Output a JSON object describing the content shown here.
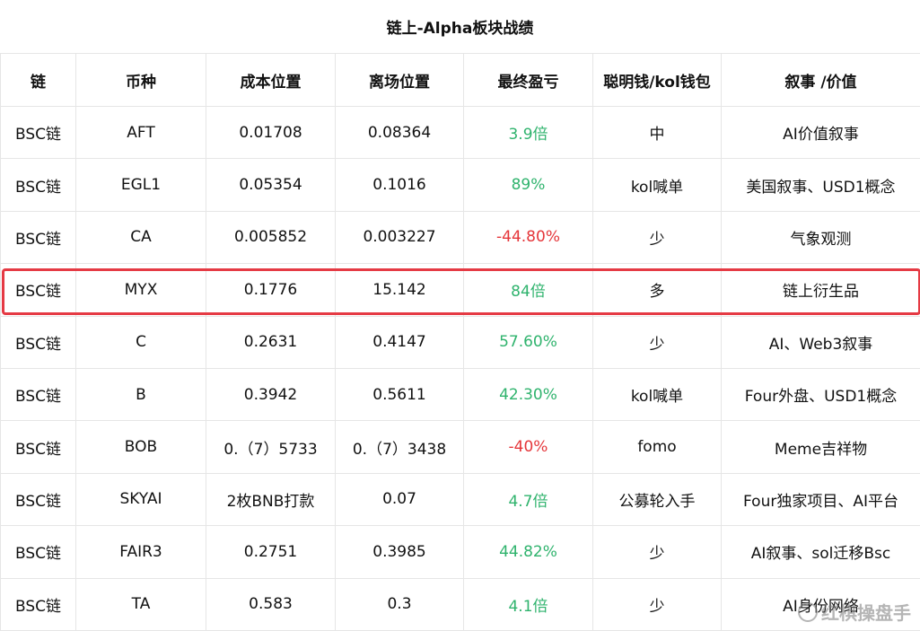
{
  "title": "链上-Alpha板块战绩",
  "headers": [
    "链",
    "币种",
    "成本位置",
    "离场位置",
    "最终盈亏",
    "聪明钱/kol钱包",
    "叙事 /价值"
  ],
  "rows": [
    {
      "chain": "BSC链",
      "coin": "AFT",
      "cost": "0.01708",
      "exit": "0.08364",
      "pnl": "3.9倍",
      "pnl_sign": "pos",
      "smart": "中",
      "story": "AI价值叙事"
    },
    {
      "chain": "BSC链",
      "coin": "EGL1",
      "cost": "0.05354",
      "exit": "0.1016",
      "pnl": "89%",
      "pnl_sign": "pos",
      "smart": "kol喊单",
      "story": "美国叙事、USD1概念"
    },
    {
      "chain": "BSC链",
      "coin": "CA",
      "cost": "0.005852",
      "exit": "0.003227",
      "pnl": "-44.80%",
      "pnl_sign": "neg",
      "smart": "少",
      "story": "气象观测"
    },
    {
      "chain": "BSC链",
      "coin": "MYX",
      "cost": "0.1776",
      "exit": "15.142",
      "pnl": "84倍",
      "pnl_sign": "pos",
      "smart": "多",
      "story": "链上衍生品"
    },
    {
      "chain": "BSC链",
      "coin": "C",
      "cost": "0.2631",
      "exit": "0.4147",
      "pnl": "57.60%",
      "pnl_sign": "pos",
      "smart": "少",
      "story": "AI、Web3叙事"
    },
    {
      "chain": "BSC链",
      "coin": "B",
      "cost": "0.3942",
      "exit": "0.5611",
      "pnl": "42.30%",
      "pnl_sign": "pos",
      "smart": "kol喊单",
      "story": "Four外盘、USD1概念"
    },
    {
      "chain": "BSC链",
      "coin": "BOB",
      "cost": "0.（7）5733",
      "exit": "0.（7）3438",
      "pnl": "-40%",
      "pnl_sign": "neg",
      "smart": "fomo",
      "story": "Meme吉祥物"
    },
    {
      "chain": "BSC链",
      "coin": "SKYAI",
      "cost": "2枚BNB打款",
      "exit": "0.07",
      "pnl": "4.7倍",
      "pnl_sign": "pos",
      "smart": "公募轮入手",
      "story": "Four独家项目、AI平台"
    },
    {
      "chain": "BSC链",
      "coin": "FAIR3",
      "cost": "0.2751",
      "exit": "0.3985",
      "pnl": "44.82%",
      "pnl_sign": "pos",
      "smart": "少",
      "story": "AI叙事、sol迁移Bsc"
    },
    {
      "chain": "BSC链",
      "coin": "TA",
      "cost": "0.583",
      "exit": "0.3",
      "pnl": "4.1倍",
      "pnl_sign": "pos",
      "smart": "少",
      "story": "AI身份网络"
    }
  ],
  "highlighted_coin": "MYX",
  "colors": {
    "positive": "#2fb36d",
    "negative": "#e5363a",
    "highlight_border": "#e53a44"
  },
  "watermark": {
    "icon": "weibo-logo-icon",
    "text": "红棋操盘手"
  }
}
